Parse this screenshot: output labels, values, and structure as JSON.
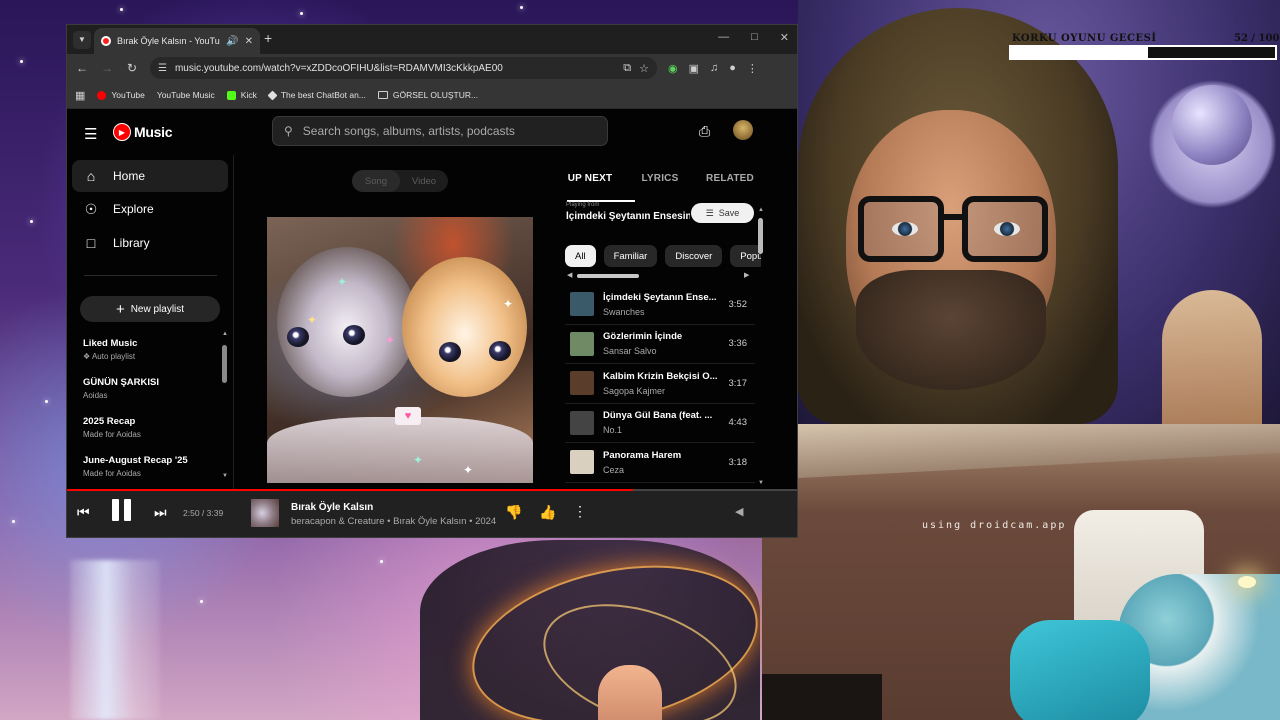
{
  "browser": {
    "tab_title": "Bırak Öyle Kalsın - YouTube",
    "new_tab": "+",
    "url": "music.youtube.com/watch?v=xZDDcoOFIHU&list=RDAMVMI3cKkkpAE00",
    "bookmarks": [
      {
        "label": "YouTube",
        "icon": "youtube-icon"
      },
      {
        "label": "YouTube Music",
        "icon": "youtube-music-icon"
      },
      {
        "label": "Kick",
        "icon": "kick-icon"
      },
      {
        "label": "The best ChatBot an...",
        "icon": "chatgpt-icon"
      },
      {
        "label": "GÖRSEL OLUŞTUR...",
        "icon": "folder-icon"
      }
    ]
  },
  "ytm": {
    "logo_text": "Music",
    "search_placeholder": "Search songs, albums, artists, podcasts",
    "nav": [
      {
        "label": "Home",
        "icon": "home-icon"
      },
      {
        "label": "Explore",
        "icon": "explore-icon"
      },
      {
        "label": "Library",
        "icon": "library-icon"
      }
    ],
    "new_playlist_label": "New playlist",
    "playlists": [
      {
        "title": "Liked Music",
        "subtitle": "Auto playlist"
      },
      {
        "title": "GÜNÜN ŞARKISI",
        "subtitle": "Aoidas"
      },
      {
        "title": "2025 Recap",
        "subtitle": "Made for Aoidas"
      },
      {
        "title": "June-August Recap '25",
        "subtitle": "Made for Aoidas"
      }
    ],
    "toggle": {
      "song": "Song",
      "video": "Video"
    },
    "right_tabs": [
      "UP NEXT",
      "LYRICS",
      "RELATED"
    ],
    "playing_from_label": "Playing from",
    "playing_from_title": "İçimdeki Şeytanın Ensesinde",
    "save_label": "Save",
    "chips": [
      "All",
      "Familiar",
      "Discover",
      "Popular"
    ],
    "queue": [
      {
        "title": "İçimdeki Şeytanın Ense...",
        "artist": "Swanches",
        "duration": "3:52",
        "thumb": "#3a5a6a"
      },
      {
        "title": "Gözlerimin İçinde",
        "artist": "Sansar Salvo",
        "duration": "3:36",
        "thumb": "#6f8a64"
      },
      {
        "title": "Kalbim Krizin Bekçisi O...",
        "artist": "Sagopa Kajmer",
        "duration": "3:17",
        "thumb": "#5a3d2a"
      },
      {
        "title": "Dünya Gül Bana (feat. ...",
        "artist": "No.1",
        "duration": "4:43",
        "thumb": "#444444"
      },
      {
        "title": "Panorama Harem",
        "artist": "Ceza",
        "duration": "3:18",
        "thumb": "#d9d0c0"
      }
    ],
    "player": {
      "time": "2:50 / 3:39",
      "progress": 0.776,
      "title": "Bırak Öyle Kalsın",
      "subtitle": "beracapon & Creature • Bırak Öyle Kalsın • 2024"
    }
  },
  "overlay": {
    "title": "KORKU OYUNU GECESİ",
    "count": "52 / 100",
    "progress": 0.52,
    "droidcam": "using droidcam.app"
  }
}
